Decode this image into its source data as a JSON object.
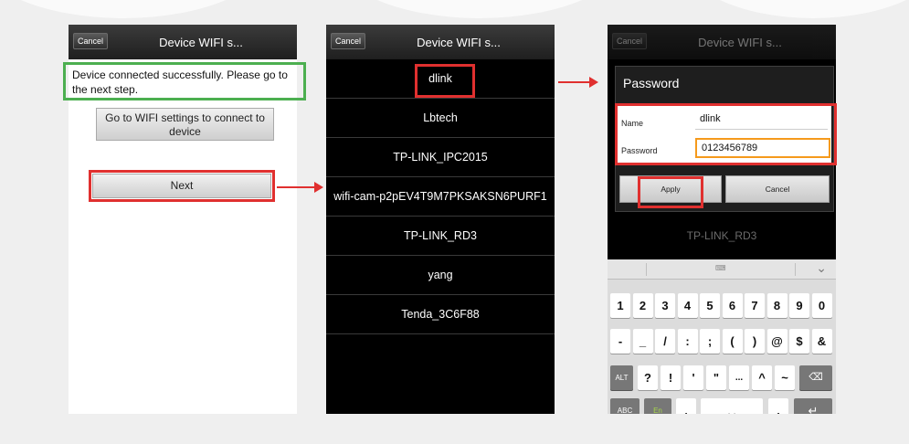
{
  "panel1": {
    "cancel": "Cancel",
    "title": "Device WIFI s...",
    "message": "Device connected successfully. Please go to the next step.",
    "wifi_settings_button": "Go to WIFI settings to connect to device",
    "next_button": "Next"
  },
  "panel2": {
    "cancel": "Cancel",
    "title": "Device WIFI s...",
    "networks": [
      "dlink",
      "Lbtech",
      "TP-LINK_IPC2015",
      "wifi-cam-p2pEV4T9M7PKSAKSN6PURF1",
      "TP-LINK_RD3",
      "yang",
      "Tenda_3C6F88"
    ]
  },
  "panel3": {
    "cancel": "Cancel",
    "title": "Device WIFI s...",
    "background_item": "TP-LINK_RD3",
    "dialog": {
      "title": "Password",
      "name_label": "Name",
      "name_value": "dlink",
      "password_label": "Password",
      "password_value": "0123456789",
      "apply": "Apply",
      "cancel": "Cancel"
    },
    "keyboard": {
      "row1": [
        "1",
        "2",
        "3",
        "4",
        "5",
        "6",
        "7",
        "8",
        "9",
        "0"
      ],
      "row2": [
        "-",
        "_",
        "/",
        ":",
        ";",
        "(",
        ")",
        "@",
        "$",
        "&"
      ],
      "row3": [
        "ALT",
        "?",
        "!",
        "'",
        "\"",
        "...",
        "^",
        "~",
        "⌫"
      ],
      "row4": [
        "ABC",
        "En",
        ",",
        "␣",
        ".",
        "↵"
      ]
    }
  },
  "colors": {
    "highlight_red": "#e0302f",
    "highlight_green": "#4caf50",
    "password_field_orange": "#f59a1c"
  }
}
